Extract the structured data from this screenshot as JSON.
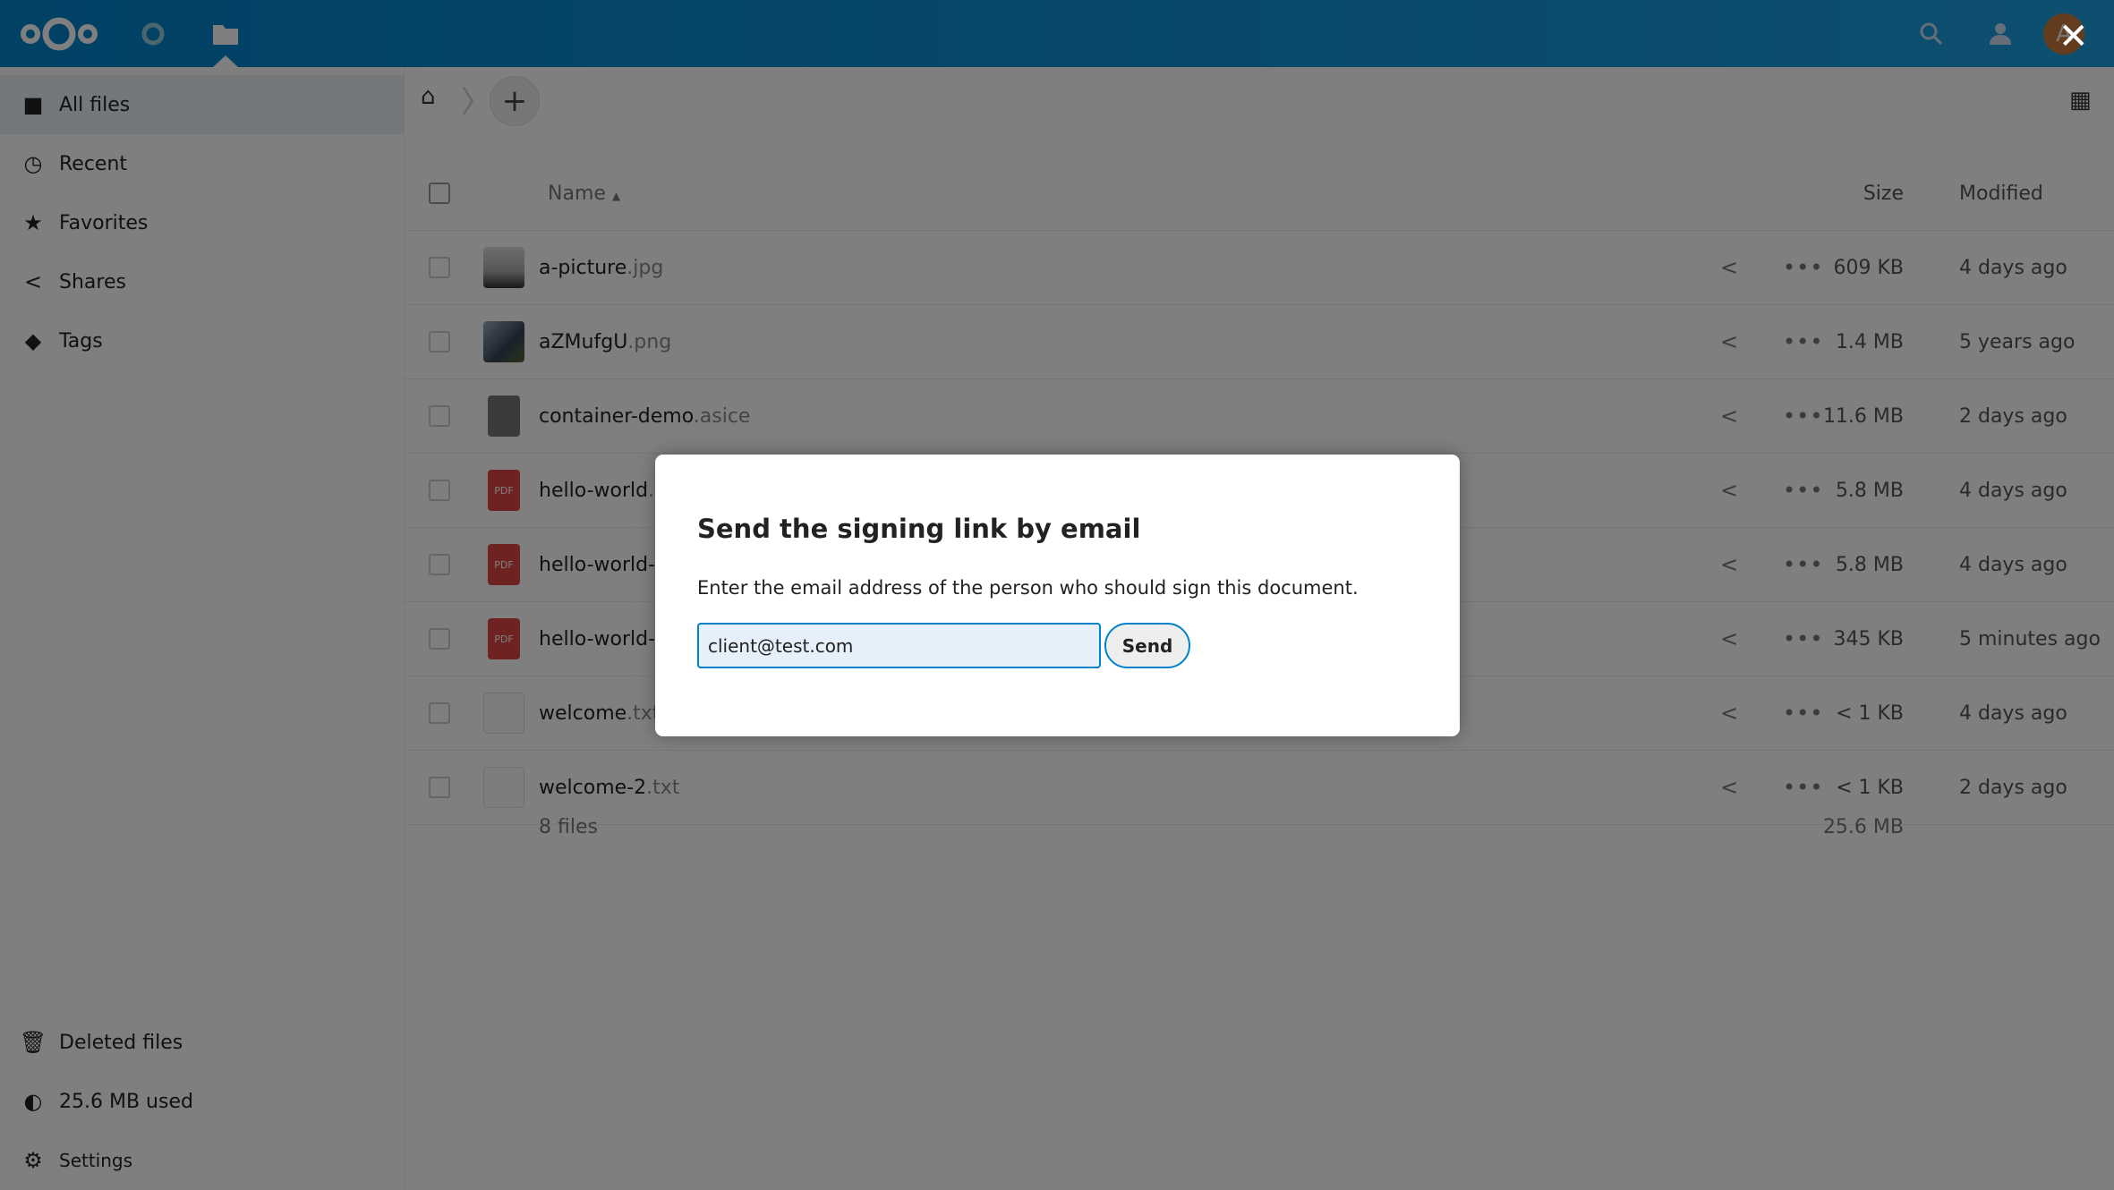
{
  "header": {
    "avatar_letter": "A",
    "accent": "#0082c9",
    "icons": [
      "nextcloud-logo",
      "activity-icon",
      "files-icon",
      "search-icon",
      "contacts-icon"
    ]
  },
  "sidebar": {
    "items": [
      {
        "label": "All files",
        "icon": "folder-icon"
      },
      {
        "label": "Recent",
        "icon": "clock-icon"
      },
      {
        "label": "Favorites",
        "icon": "star-icon"
      },
      {
        "label": "Shares",
        "icon": "share-icon"
      },
      {
        "label": "Tags",
        "icon": "tag-icon"
      }
    ],
    "bottom": [
      {
        "label": "Deleted files",
        "icon": "trash-icon"
      },
      {
        "label": "25.6 MB used",
        "icon": "pie-icon"
      },
      {
        "label": "Settings",
        "icon": "gear-icon"
      }
    ]
  },
  "list": {
    "headers": {
      "name": "Name",
      "size": "Size",
      "modified": "Modified"
    },
    "files": [
      {
        "name": "a-picture",
        "ext": ".jpg",
        "size": "609 KB",
        "modified": "4 days ago",
        "type": "image"
      },
      {
        "name": "aZMufgU",
        "ext": ".png",
        "size": "1.4 MB",
        "modified": "5 years ago",
        "type": "image2"
      },
      {
        "name": "container-demo",
        "ext": ".asice",
        "size": "11.6 MB",
        "modified": "2 days ago",
        "type": "file"
      },
      {
        "name": "hello-world",
        "ext": ".pdf",
        "size": "5.8 MB",
        "modified": "4 days ago",
        "type": "pdf"
      },
      {
        "name": "hello-world-2",
        "ext": "",
        "size": "5.8 MB",
        "modified": "4 days ago",
        "type": "pdf"
      },
      {
        "name": "hello-world-3",
        "ext": "",
        "size": "345 KB",
        "modified": "5 minutes ago",
        "type": "pdf"
      },
      {
        "name": "welcome",
        "ext": ".txt",
        "size": "< 1 KB",
        "modified": "4 days ago",
        "type": "text"
      },
      {
        "name": "welcome-2",
        "ext": ".txt",
        "size": "< 1 KB",
        "modified": "2 days ago",
        "type": "text"
      }
    ],
    "summary": {
      "count": "8 files",
      "size": "25.6 MB"
    }
  },
  "dialog": {
    "title": "Send the signing link by email",
    "text": "Enter the email address of the person who should sign this document.",
    "email_value": "client@test.com",
    "send_label": "Send",
    "close": "✕"
  }
}
